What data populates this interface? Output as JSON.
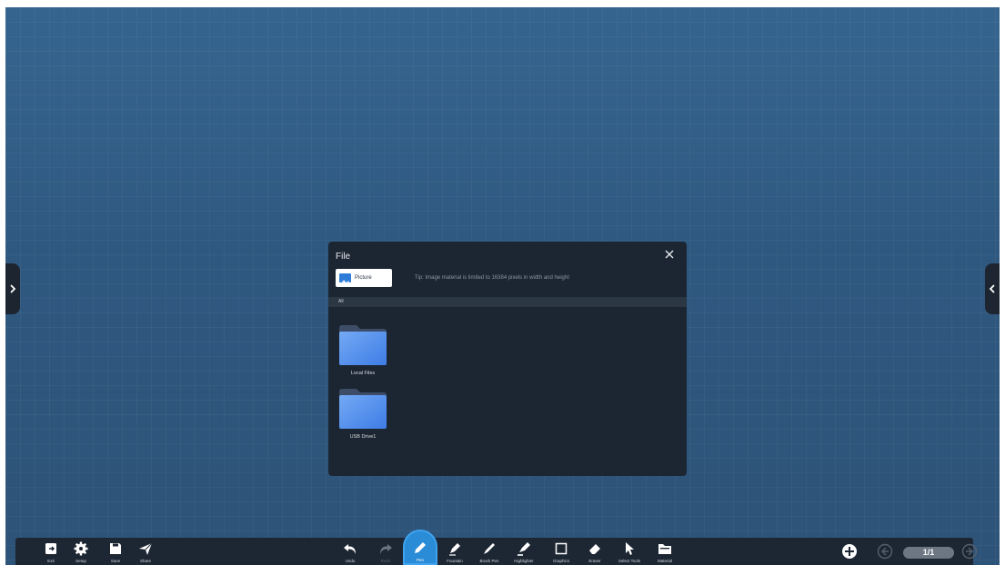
{
  "dialog": {
    "title": "File",
    "picture_tab": "Picture",
    "tip": "Tip: Image material is limited to 16384 pixels in width and height",
    "breadcrumb": "All",
    "folders": [
      {
        "label": "Local Files",
        "icon": "folder-icon"
      },
      {
        "label": "USB Drive1",
        "icon": "folder-icon"
      }
    ]
  },
  "toolbar": {
    "left": [
      {
        "label": "Exit",
        "icon": "exit-icon"
      },
      {
        "label": "Setup",
        "icon": "gear-icon"
      },
      {
        "label": "Save",
        "icon": "save-icon"
      },
      {
        "label": "Share",
        "icon": "share-icon"
      }
    ],
    "center": [
      {
        "label": "Undo",
        "icon": "undo-icon",
        "enabled": true
      },
      {
        "label": "Redo",
        "icon": "redo-icon",
        "enabled": false
      },
      {
        "label": "Pen",
        "icon": "pen-icon",
        "active": true
      },
      {
        "label": "Fountain",
        "icon": "fountain-pen-icon"
      },
      {
        "label": "Brush Pen",
        "icon": "brush-pen-icon"
      },
      {
        "label": "Highlighter",
        "icon": "highlighter-icon"
      },
      {
        "label": "Graphics",
        "icon": "square-icon"
      },
      {
        "label": "Eraser",
        "icon": "eraser-icon"
      },
      {
        "label": "Select Tools",
        "icon": "cursor-icon"
      },
      {
        "label": "Material",
        "icon": "folder-icon"
      }
    ],
    "page_indicator": "1/1"
  },
  "colors": {
    "canvas_top": "#35658f",
    "canvas_bottom": "#2e5378",
    "dialog_bg": "#1c2632",
    "toolbar_bg": "#1d2633",
    "active_tool": "#2a8bd6",
    "folder_blue": "#5b9af0"
  }
}
